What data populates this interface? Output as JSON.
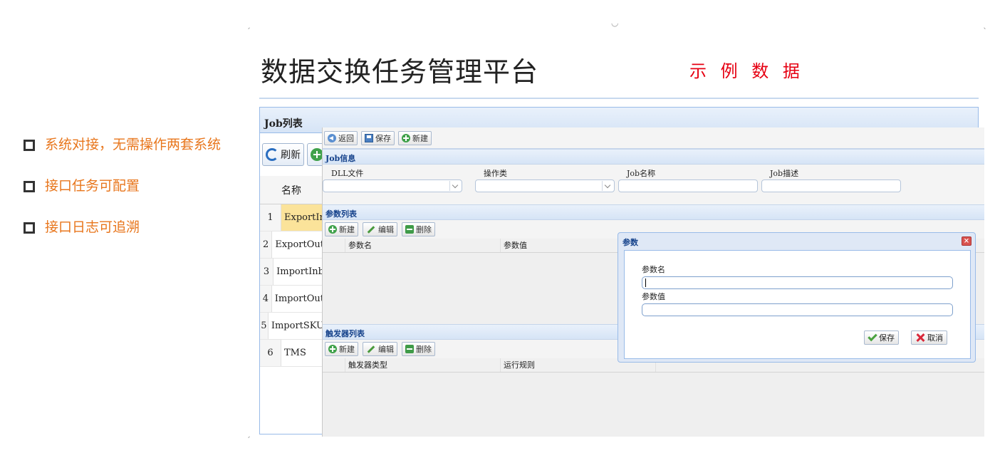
{
  "slide": {
    "title": "数据交换任务管理平台",
    "sample_tag": "示 例 数 据",
    "bullets": [
      "系统对接，无需操作两套系统",
      "接口任务可配置",
      "接口日志可追溯"
    ]
  },
  "job_list": {
    "title": "Job列表",
    "refresh_label": "刷新",
    "column_name": "名称",
    "rows": [
      {
        "num": "1",
        "name": "ExportInb"
      },
      {
        "num": "2",
        "name": "ExportOut"
      },
      {
        "num": "3",
        "name": "ImportInb"
      },
      {
        "num": "4",
        "name": "ImportOut"
      },
      {
        "num": "5",
        "name": "ImportSKU"
      },
      {
        "num": "6",
        "name": "TMS"
      }
    ]
  },
  "edit_window": {
    "toolbar": {
      "back": "返回",
      "save": "保存",
      "new": "新建"
    },
    "job_info": {
      "title": "Job信息",
      "fields": [
        {
          "label": "DLL文件",
          "value": ""
        },
        {
          "label": "操作类",
          "value": ""
        },
        {
          "label": "Job名称",
          "value": ""
        },
        {
          "label": "Job描述",
          "value": ""
        }
      ]
    },
    "params": {
      "title": "参数列表",
      "new": "新建",
      "edit": "编辑",
      "delete": "删除",
      "columns": [
        "参数名",
        "参数值"
      ]
    },
    "triggers": {
      "title": "触发器列表",
      "new": "新建",
      "edit": "编辑",
      "delete": "删除",
      "columns": [
        "触发器类型",
        "运行规则"
      ]
    }
  },
  "param_dialog": {
    "title": "参数",
    "name_label": "参数名",
    "name_value": "",
    "value_label": "参数值",
    "value_value": "",
    "save": "保存",
    "cancel": "取消"
  },
  "colors": {
    "sample_tag": "#e60012",
    "bullet_text": "#e8761c",
    "panel_border": "#99bbe8",
    "selected_row": "#fbe39a"
  }
}
